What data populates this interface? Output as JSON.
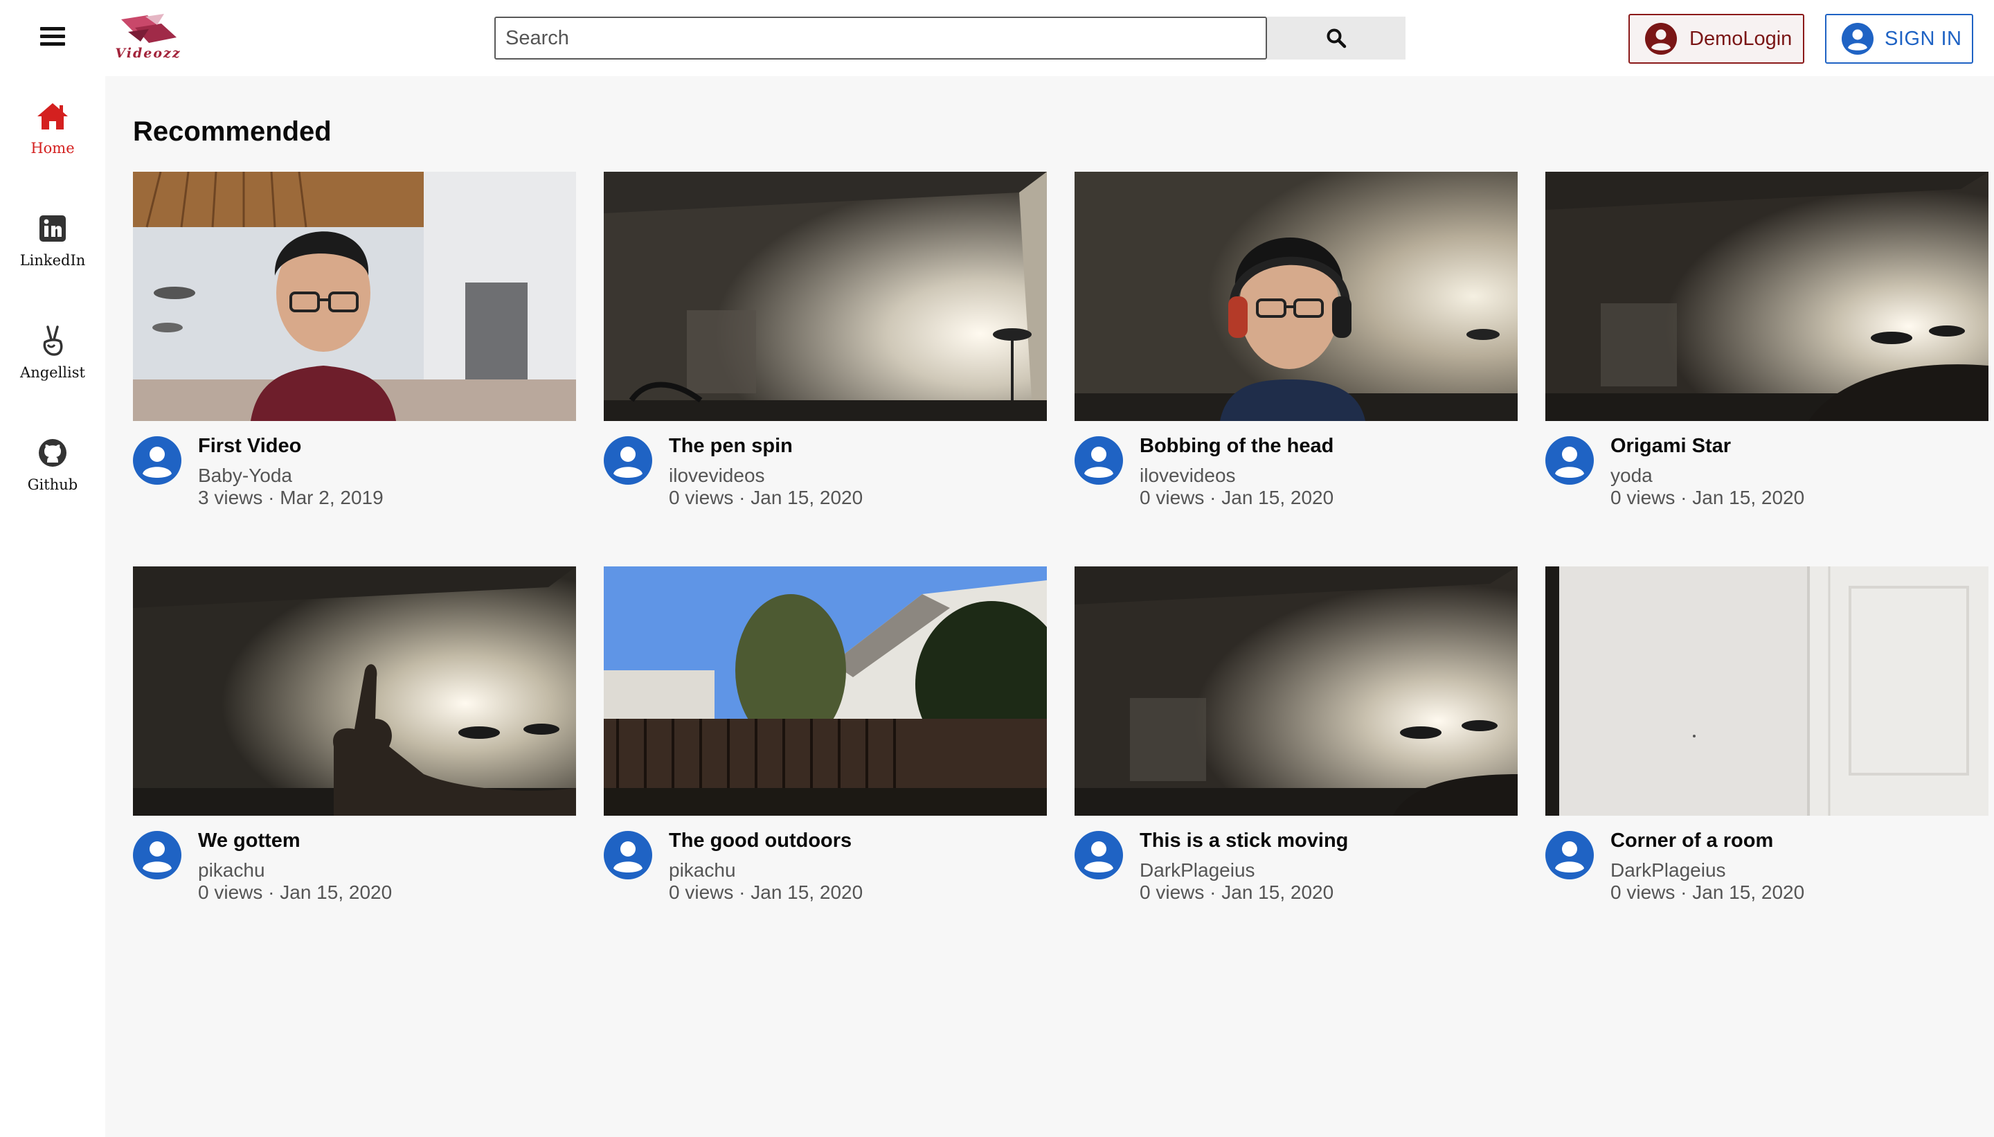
{
  "header": {
    "menu_icon": "hamburger-menu-icon",
    "logo_text": "Videozz",
    "search_placeholder": "Search",
    "search_icon": "search-icon",
    "demo_login_label": "DemoLogin",
    "sign_in_label": "SIGN IN",
    "user_icon": "account-circle-icon"
  },
  "sidebar": {
    "items": [
      {
        "label": "Home",
        "icon": "home-icon",
        "active": true
      },
      {
        "label": "LinkedIn",
        "icon": "linkedin-icon",
        "active": false
      },
      {
        "label": "Angellist",
        "icon": "angellist-icon",
        "active": false
      },
      {
        "label": "Github",
        "icon": "github-icon",
        "active": false
      }
    ]
  },
  "main": {
    "section_title": "Recommended",
    "videos": [
      {
        "title": "First Video",
        "channel": "Baby-Yoda",
        "meta": "3 views · Mar 2, 2019",
        "thumb": "person-with-glasses-in-office"
      },
      {
        "title": "The pen spin",
        "channel": "ilovevideos",
        "meta": "0 views · Jan 15, 2020",
        "thumb": "dim-room-with-lamp"
      },
      {
        "title": "Bobbing of the head",
        "channel": "ilovevideos",
        "meta": "0 views · Jan 15, 2020",
        "thumb": "person-with-headphones"
      },
      {
        "title": "Origami Star",
        "channel": "yoda",
        "meta": "0 views · Jan 15, 2020",
        "thumb": "dim-room-with-lamp"
      },
      {
        "title": "We gottem",
        "channel": "pikachu",
        "meta": "0 views · Jan 15, 2020",
        "thumb": "thumbs-up-silhouette"
      },
      {
        "title": "The good outdoors",
        "channel": "pikachu",
        "meta": "0 views · Jan 15, 2020",
        "thumb": "backyard-trees-and-house"
      },
      {
        "title": "This is a stick moving",
        "channel": "DarkPlageius",
        "meta": "0 views · Jan 15, 2020",
        "thumb": "dim-room-with-lamp"
      },
      {
        "title": "Corner of a room",
        "channel": "DarkPlageius",
        "meta": "0 views · Jan 15, 2020",
        "thumb": "white-wall-and-door"
      }
    ]
  },
  "colors": {
    "accent_red": "#d4201f",
    "brand_blue": "#1f63c4",
    "demo_red": "#7a1616",
    "main_bg": "#f7f7f7"
  }
}
